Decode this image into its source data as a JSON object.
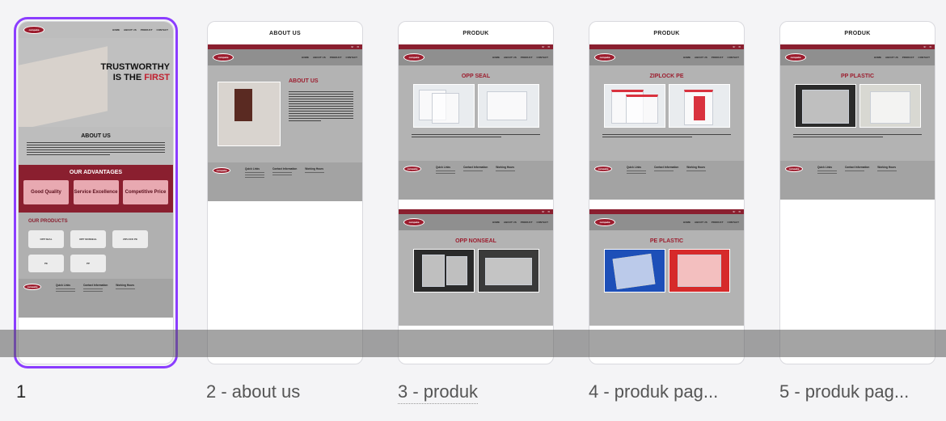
{
  "pages": [
    {
      "label": "1",
      "nav": [
        "HOME",
        "ABOUT US",
        "PRODUCT",
        "CONTACT"
      ],
      "hero": {
        "line1": "TRUSTWORTHY",
        "line2a": "IS THE ",
        "line2b": "FIRST"
      },
      "about_title": "ABOUT US",
      "advantages_title": "OUR ADVANTAGES",
      "advantages": [
        "Good Quality",
        "Service Excellence",
        "Competitive Price"
      ],
      "products_title": "OUR PRODUCTS",
      "products": [
        "OPP SEAL",
        "OPP NONSEAL",
        "ZIPLOCK PE",
        "PE",
        "PP"
      ],
      "footer": [
        "Quick Links",
        "Contact Information",
        "Working Hours"
      ]
    },
    {
      "label": "2 - about us",
      "head": "ABOUT US",
      "nav": [
        "HOME",
        "ABOUT US",
        "PRODUCT",
        "CONTACT"
      ],
      "section_title": "ABOUT US",
      "footer": [
        "Quick Links",
        "Contact Information",
        "Working Hours"
      ]
    },
    {
      "label": "3 - produk",
      "head": "PRODUK",
      "nav": [
        "HOME",
        "ABOUT US",
        "PRODUCT",
        "CONTACT"
      ],
      "section_title": "OPP SEAL",
      "section2_title": "OPP NONSEAL",
      "footer": [
        "Quick Links",
        "Contact Information",
        "Working Hours"
      ]
    },
    {
      "label": "4 - produk pag...",
      "head": "PRODUK",
      "nav": [
        "HOME",
        "ABOUT US",
        "PRODUCT",
        "CONTACT"
      ],
      "section_title": "ZIPLOCK PE",
      "section2_title": "PE PLASTIC",
      "footer": [
        "Quick Links",
        "Contact Information",
        "Working Hours"
      ]
    },
    {
      "label": "5 - produk pag...",
      "head": "PRODUK",
      "nav": [
        "HOME",
        "ABOUT US",
        "PRODUCT",
        "CONTACT"
      ],
      "section_title": "PP PLASTIC",
      "footer": [
        "Quick Links",
        "Contact Information",
        "Working Hours"
      ]
    }
  ],
  "colors": {
    "accent": "#8b3dff",
    "brand": "#8a1f2f"
  }
}
